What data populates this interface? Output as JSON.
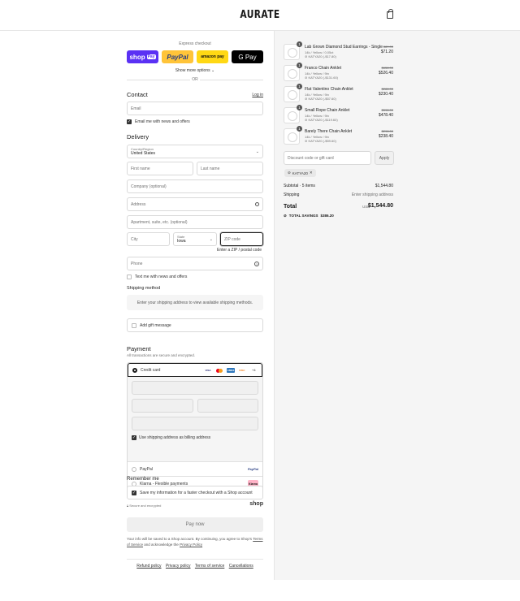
{
  "header": {
    "logo": "AURATE",
    "cart_icon": "shopping-bag-icon"
  },
  "express": {
    "title": "Express checkout",
    "shop_pay": "shop",
    "shop_pay_badge": "Pay",
    "paypal": "PayPal",
    "amazon_pay": "amazon pay",
    "google_pay": "G Pay",
    "more_options": "Show more options ⌄",
    "or": "OR"
  },
  "contact": {
    "title": "Contact",
    "login": "Log in",
    "email_placeholder": "Email",
    "news_label": "Email me with news and offers"
  },
  "delivery": {
    "title": "Delivery",
    "country_label": "Country/Region",
    "country_value": "United States",
    "first_name": "First name",
    "last_name": "Last name",
    "company": "Company (optional)",
    "address": "Address",
    "apartment": "Apartment, suite, etc. (optional)",
    "city": "City",
    "state_label": "State",
    "state_value": "Iowa",
    "zip": "ZIP code",
    "zip_error": "Enter a ZIP / postal code",
    "phone": "Phone",
    "text_label": "Text me with news and offers"
  },
  "shipping": {
    "title": "Shipping method",
    "message": "Enter your shipping address to view available shipping methods."
  },
  "gift": {
    "label": "Add gift message"
  },
  "payment": {
    "title": "Payment",
    "subtitle": "All transactions are secure and encrypted.",
    "credit_card": "Credit card",
    "card_more": "+4",
    "billing_label": "Use shipping address as billing address",
    "paypal": "PayPal",
    "klarna": "Klarna - Flexible payments",
    "klarna_badge": "Klarna"
  },
  "remember": {
    "title": "Remember me",
    "label": "Save my information for a faster checkout with a Shop account",
    "secure": "Secure and encrypted",
    "shop": "shop"
  },
  "pay_now": "Pay now",
  "legal": {
    "text1": "Your info will be saved to a Shop account. By continuing, you agree to Shop's",
    "terms": "Terms of Service",
    "text2": "and acknowledge the",
    "privacy": "Privacy Policy"
  },
  "footer": {
    "links": [
      "Refund policy",
      "Privacy policy",
      "Terms of service",
      "Cancellations"
    ]
  },
  "order": {
    "items": [
      {
        "qty": "1",
        "name": "Lab Grown Diamond Stud Earrings - Single",
        "variant": "14k / Yellow / 0.05ct",
        "discount": "KATYA20 (-$17.80)",
        "original": "$89.00",
        "price": "$71.20"
      },
      {
        "qty": "1",
        "name": "Franco Chain Anklet",
        "variant": "14k / Yellow / 9in",
        "discount": "KATYA20 (-$131.60)",
        "original": "$658.00",
        "price": "$526.40"
      },
      {
        "qty": "1",
        "name": "Flat Valentino Chain Anklet",
        "variant": "14k / Yellow / 9in",
        "discount": "KATYA20 (-$57.60)",
        "original": "$288.00",
        "price": "$230.40"
      },
      {
        "qty": "1",
        "name": "Small Rope Chain Anklet",
        "variant": "14k / Yellow / 9in",
        "discount": "KATYA20 (-$119.60)",
        "original": "$598.00",
        "price": "$478.40"
      },
      {
        "qty": "1",
        "name": "Barely There Chain Anklet",
        "variant": "14k / Yellow / 9in",
        "discount": "KATYA20 (-$59.60)",
        "original": "$298.00",
        "price": "$238.40"
      }
    ],
    "discount_placeholder": "Discount code or gift card",
    "apply": "Apply",
    "applied_code": "KATYA20",
    "subtotal_label": "Subtotal · 5 items",
    "subtotal_value": "$1,544.80",
    "shipping_label": "Shipping",
    "shipping_value": "Enter shipping address",
    "total_label": "Total",
    "currency": "USD",
    "total_value": "$1,544.80",
    "savings_label": "TOTAL SAVINGS",
    "savings_value": "$386.20"
  }
}
